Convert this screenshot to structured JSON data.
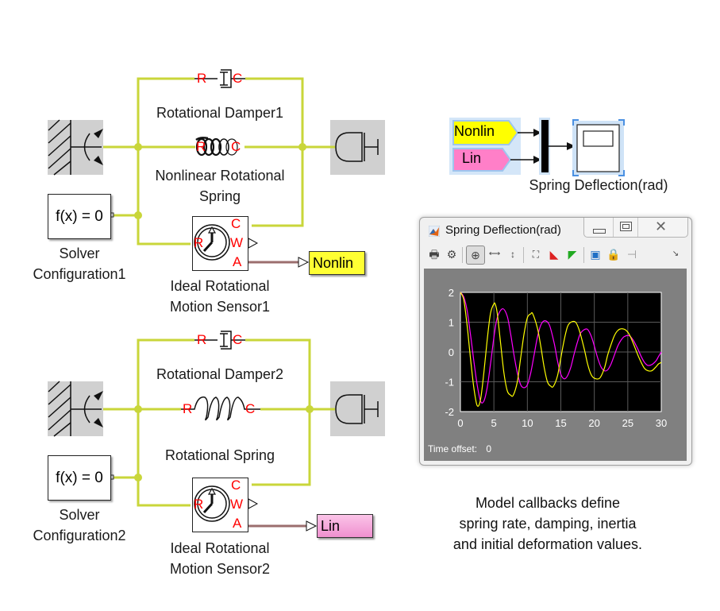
{
  "model": {
    "wire_color": "#c9d63a",
    "signal_color": "#9b6e6e",
    "port_label_color": "#ff0000"
  },
  "circuit1": {
    "damper_label": "Rotational Damper1",
    "spring_label_line1": "Nonlinear Rotational",
    "spring_label_line2": "Spring",
    "solver_text": "f(x) = 0",
    "solver_label_line1": "Solver",
    "solver_label_line2": "Configuration1",
    "sensor_label_line1": "Ideal Rotational",
    "sensor_label_line2": "Motion Sensor1",
    "goto_tag": "Nonlin",
    "goto_color": "#ffff33",
    "ports": {
      "damper_r": "R",
      "damper_c": "C",
      "spring_r": "R",
      "spring_c": "C",
      "sensor_r": "R",
      "sensor_c": "C",
      "sensor_w": "W",
      "sensor_a": "A"
    }
  },
  "circuit2": {
    "damper_label": "Rotational Damper2",
    "spring_label": "Rotational Spring",
    "solver_text": "f(x) = 0",
    "solver_label_line1": "Solver",
    "solver_label_line2": "Configuration2",
    "sensor_label_line1": "Ideal Rotational",
    "sensor_label_line2": "Motion Sensor2",
    "goto_tag": "Lin",
    "goto_color": "#f5a6d8",
    "ports": {
      "damper_r": "R",
      "damper_c": "C",
      "spring_r": "R",
      "spring_c": "C",
      "sensor_r": "R",
      "sensor_c": "C",
      "sensor_w": "W",
      "sensor_a": "A"
    }
  },
  "scope_block": {
    "from_nonlin": "Nonlin",
    "from_lin": "Lin",
    "from_nonlin_color": "#ffff00",
    "from_lin_color": "#ff7fc8",
    "label": "Spring Deflection(rad)"
  },
  "scope_window": {
    "title": "Spring Deflection(rad)",
    "window_buttons": [
      "minimize",
      "maximize",
      "close"
    ],
    "toolbar": [
      "print-icon",
      "settings-icon",
      "zoom-in-icon",
      "zoom-x-icon",
      "zoom-y-icon",
      "autoscale-icon",
      "save-axes-icon",
      "restore-axes-icon",
      "float-icon",
      "lock-icon",
      "select-signal-icon"
    ],
    "time_offset_label": "Time offset:",
    "time_offset_value": "0"
  },
  "chart_data": {
    "type": "line",
    "title": "",
    "xlabel": "",
    "ylabel": "",
    "xlim": [
      0,
      30
    ],
    "ylim": [
      -2,
      2
    ],
    "xticks": [
      0,
      5,
      10,
      15,
      20,
      25,
      30
    ],
    "yticks": [
      -2,
      -1,
      0,
      1,
      2
    ],
    "xtick_labels": [
      "0",
      "5",
      "10",
      "15",
      "20",
      "25",
      "30"
    ],
    "ytick_labels": [
      "-2",
      "-1",
      "0",
      "1",
      "2"
    ],
    "grid": true,
    "background": "#000000",
    "series": [
      {
        "name": "Nonlin",
        "color": "#ffff00",
        "x": [
          0,
          0.5,
          1.0,
          1.5,
          2.0,
          2.5,
          3.0,
          3.5,
          4.0,
          4.5,
          5.0,
          5.2,
          5.5,
          6.0,
          6.5,
          7.0,
          7.5,
          7.9,
          8.5,
          9.0,
          9.5,
          10.0,
          10.5,
          10.8,
          11.5,
          12.0,
          12.5,
          13.0,
          13.5,
          13.9,
          14.5,
          15.0,
          15.5,
          16.0,
          16.5,
          17.2,
          17.8,
          18.5,
          19.0,
          19.5,
          20.0,
          20.8,
          21.5,
          22.0,
          22.5,
          23.0,
          23.5,
          24.0,
          24.6,
          25.2,
          25.8,
          26.5,
          27.0,
          27.5,
          28.0,
          28.6,
          29.2,
          29.6,
          30.0
        ],
        "values": [
          2.0,
          1.75,
          0.9,
          -0.2,
          -1.2,
          -1.8,
          -1.6,
          -0.7,
          0.4,
          1.3,
          1.62,
          1.6,
          1.3,
          0.3,
          -0.7,
          -1.3,
          -1.45,
          -1.45,
          -1.0,
          -0.2,
          0.6,
          1.15,
          1.28,
          1.28,
          0.8,
          0.2,
          -0.5,
          -1.0,
          -1.15,
          -1.15,
          -0.8,
          -0.2,
          0.4,
          0.85,
          1.0,
          1.0,
          0.7,
          0.1,
          -0.4,
          -0.75,
          -0.88,
          -0.88,
          -0.55,
          -0.1,
          0.25,
          0.55,
          0.72,
          0.78,
          0.75,
          0.6,
          0.3,
          -0.1,
          -0.35,
          -0.55,
          -0.63,
          -0.63,
          -0.5,
          -0.4,
          -0.35
        ]
      },
      {
        "name": "Lin",
        "color": "#ff00ff",
        "x": [
          0,
          0.5,
          1.0,
          1.5,
          2.0,
          2.5,
          3.0,
          3.5,
          4.0,
          4.5,
          5.0,
          5.5,
          6.3,
          7.0,
          7.5,
          8.0,
          8.5,
          9.0,
          9.5,
          10.0,
          10.5,
          11.0,
          11.5,
          12.0,
          12.6,
          13.3,
          14.0,
          14.5,
          15.0,
          15.5,
          16.0,
          16.5,
          17.0,
          17.5,
          18.0,
          18.9,
          19.5,
          20.0,
          20.5,
          21.0,
          21.5,
          22.0,
          22.5,
          23.0,
          23.5,
          24.0,
          24.5,
          25.2,
          25.8,
          26.5,
          27.0,
          27.5,
          28.0,
          28.6,
          29.2,
          29.6,
          30.0
        ],
        "values": [
          2.0,
          1.85,
          1.4,
          0.6,
          -0.3,
          -1.1,
          -1.65,
          -1.65,
          -1.2,
          -0.4,
          0.5,
          1.15,
          1.45,
          1.2,
          0.6,
          -0.1,
          -0.7,
          -1.1,
          -1.2,
          -1.1,
          -0.7,
          -0.1,
          0.5,
          0.9,
          1.05,
          0.9,
          0.3,
          -0.3,
          -0.75,
          -0.9,
          -0.8,
          -0.5,
          -0.05,
          0.35,
          0.65,
          0.77,
          0.55,
          0.2,
          -0.2,
          -0.5,
          -0.63,
          -0.6,
          -0.4,
          -0.1,
          0.2,
          0.4,
          0.52,
          0.55,
          0.4,
          0.1,
          -0.15,
          -0.35,
          -0.45,
          -0.42,
          -0.3,
          -0.15,
          0.0
        ]
      }
    ]
  },
  "note": {
    "line1": "Model callbacks define",
    "line2": "spring rate, damping, inertia",
    "line3": "and initial deformation values."
  }
}
